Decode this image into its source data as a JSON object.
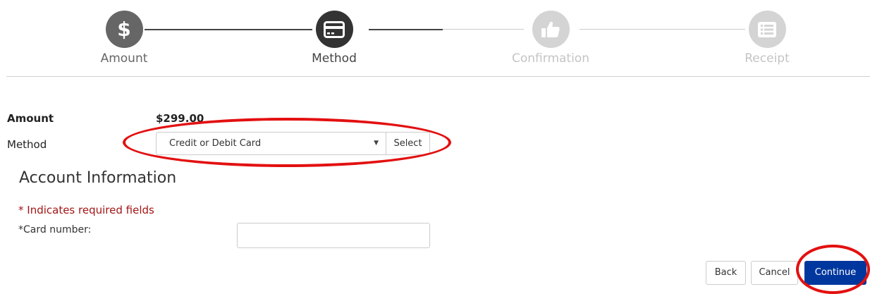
{
  "stepper": {
    "steps": [
      {
        "label": "Amount",
        "state": "done",
        "icon": "dollar-icon"
      },
      {
        "label": "Method",
        "state": "current",
        "icon": "credit-card-icon"
      },
      {
        "label": "Confirmation",
        "state": "future",
        "icon": "thumbs-up-icon"
      },
      {
        "label": "Receipt",
        "state": "future",
        "icon": "list-icon"
      }
    ],
    "icon_glyphs": {
      "dollar": "$"
    }
  },
  "summary": {
    "amount_label": "Amount",
    "amount_value": "$299.00",
    "method_label": "Method",
    "method_selected": "Credit or Debit Card",
    "method_select_button": "Select",
    "dropdown_arrow": "▼"
  },
  "account": {
    "title": "Account Information",
    "required_note": "* Indicates required fields",
    "card_number_label": "*Card number:",
    "card_number_value": ""
  },
  "actions": {
    "back": "Back",
    "cancel": "Cancel",
    "continue": "Continue"
  },
  "colors": {
    "primary": "#00379e",
    "required": "#a31515",
    "annotation": "#e31010",
    "step_done": "#666666",
    "step_current": "#333333",
    "step_future": "#d4d4d4"
  }
}
